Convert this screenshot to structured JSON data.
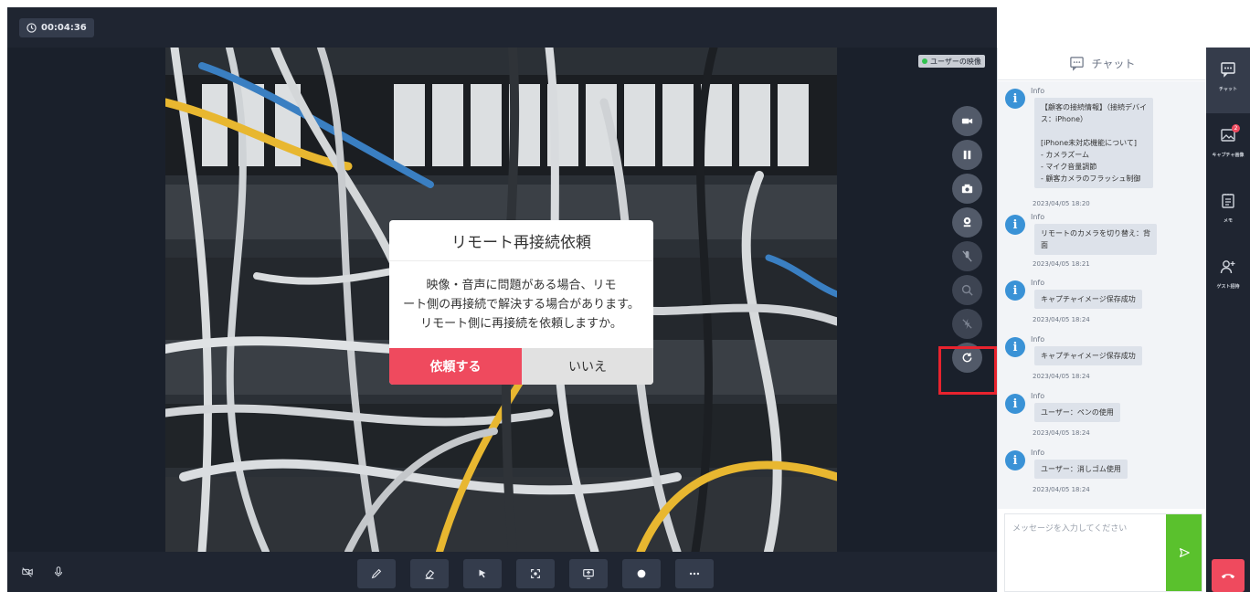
{
  "header": {
    "timer": "00:04:36"
  },
  "video": {
    "user_video_label": "ユーザーの映像"
  },
  "dialog": {
    "title": "リモート再接続依頼",
    "lines": [
      "映像・音声に問題がある場合、リモ",
      "ート側の再接続で解決する場合があります。",
      "リモート側に再接続を依頼しますか。"
    ],
    "confirm_label": "依頼する",
    "cancel_label": "いいえ"
  },
  "side_tools": [
    {
      "icon": "video-camera-icon"
    },
    {
      "icon": "pause-icon"
    },
    {
      "icon": "camera-snapshot-icon"
    },
    {
      "icon": "switch-camera-icon"
    },
    {
      "icon": "mic-off-icon"
    },
    {
      "icon": "zoom-icon"
    },
    {
      "icon": "flash-off-icon"
    },
    {
      "icon": "reconnect-icon"
    }
  ],
  "bottom_toolbar": {
    "left_icons": [
      "camera-off-icon",
      "microphone-icon"
    ],
    "tools": [
      "pen-icon",
      "eraser-icon",
      "pointer-icon",
      "capture-icon",
      "screen-share-icon",
      "record-icon",
      "more-icon"
    ]
  },
  "chat": {
    "title": "チャット",
    "messages": [
      {
        "sender": "Info",
        "text": "【顧客の接続情報】（接続デバイ\nス：iPhone）\n\n[iPhone未対応機能について]\n- カメラズーム\n- マイク音量調節\n- 顧客カメラのフラッシュ制御",
        "time": "2023/04/05 18:20"
      },
      {
        "sender": "Info",
        "text": "リモートのカメラを切り替え：背\n面",
        "time": "2023/04/05 18:21"
      },
      {
        "sender": "Info",
        "text": "キャプチャイメージ保存成功",
        "time": "2023/04/05 18:24"
      },
      {
        "sender": "Info",
        "text": "キャプチャイメージ保存成功",
        "time": "2023/04/05 18:24"
      },
      {
        "sender": "Info",
        "text": "ユーザー：ペンの使用",
        "time": "2023/04/05 18:24"
      },
      {
        "sender": "Info",
        "text": "ユーザー：消しゴム使用",
        "time": "2023/04/05 18:24"
      }
    ],
    "input_placeholder": "メッセージを入力してください"
  },
  "right_nav": {
    "items": [
      {
        "label": "チャット",
        "icon": "chat-icon"
      },
      {
        "label": "キャプチャ画像",
        "icon": "image-icon",
        "badge": "2"
      },
      {
        "label": "メモ",
        "icon": "memo-icon"
      },
      {
        "label": "ゲスト招待",
        "icon": "add-guest-icon"
      }
    ]
  },
  "colors": {
    "dark": "#1f2531",
    "accent_red": "#ef4a5e",
    "send_green": "#5ac12d",
    "info_blue": "#3a92d6",
    "highlight": "#e8232e"
  }
}
